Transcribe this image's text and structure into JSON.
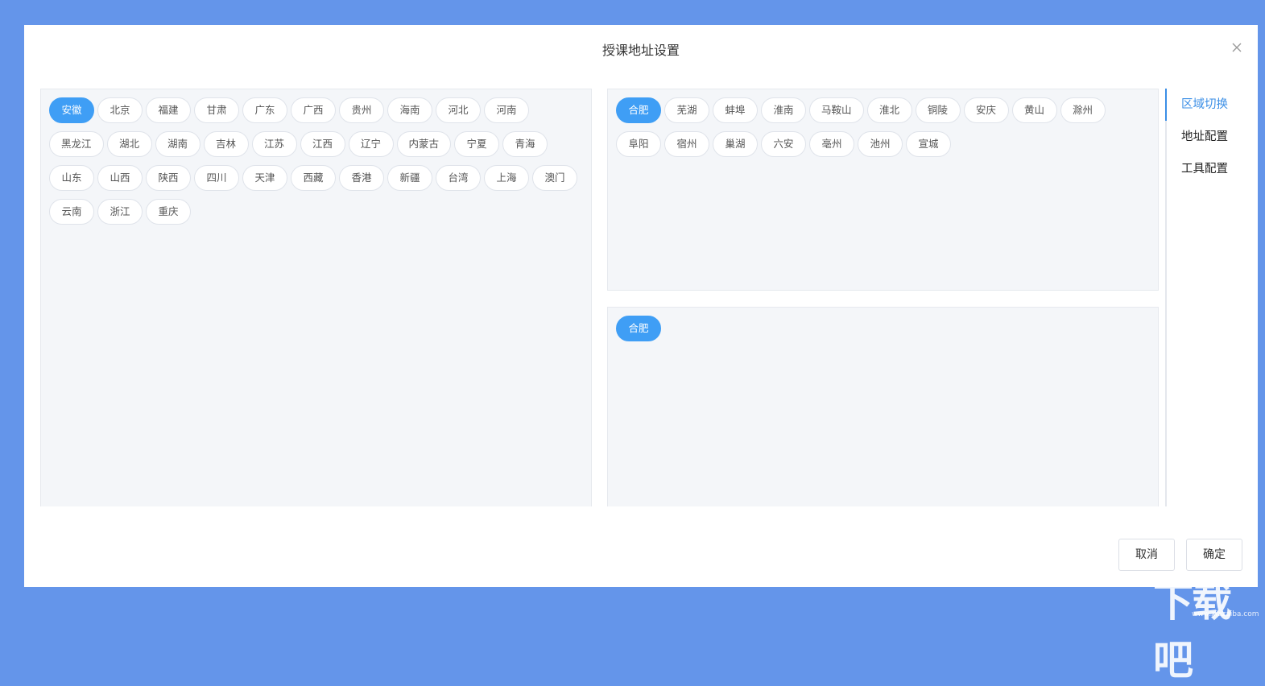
{
  "dialog": {
    "title": "授课地址设置"
  },
  "provinces": [
    {
      "label": "安徽",
      "active": true
    },
    {
      "label": "北京"
    },
    {
      "label": "福建"
    },
    {
      "label": "甘肃"
    },
    {
      "label": "广东"
    },
    {
      "label": "广西"
    },
    {
      "label": "贵州"
    },
    {
      "label": "海南"
    },
    {
      "label": "河北"
    },
    {
      "label": "河南"
    },
    {
      "label": "黑龙江"
    },
    {
      "label": "湖北"
    },
    {
      "label": "湖南"
    },
    {
      "label": "吉林"
    },
    {
      "label": "江苏"
    },
    {
      "label": "江西"
    },
    {
      "label": "辽宁"
    },
    {
      "label": "内蒙古"
    },
    {
      "label": "宁夏"
    },
    {
      "label": "青海"
    },
    {
      "label": "山东"
    },
    {
      "label": "山西"
    },
    {
      "label": "陕西"
    },
    {
      "label": "四川"
    },
    {
      "label": "天津"
    },
    {
      "label": "西藏"
    },
    {
      "label": "香港"
    },
    {
      "label": "新疆"
    },
    {
      "label": "台湾"
    },
    {
      "label": "上海"
    },
    {
      "label": "澳门"
    },
    {
      "label": "云南"
    },
    {
      "label": "浙江"
    },
    {
      "label": "重庆"
    }
  ],
  "cities": [
    {
      "label": "合肥",
      "active": true
    },
    {
      "label": "芜湖"
    },
    {
      "label": "蚌埠"
    },
    {
      "label": "淮南"
    },
    {
      "label": "马鞍山"
    },
    {
      "label": "淮北"
    },
    {
      "label": "铜陵"
    },
    {
      "label": "安庆"
    },
    {
      "label": "黄山"
    },
    {
      "label": "滁州"
    },
    {
      "label": "阜阳"
    },
    {
      "label": "宿州"
    },
    {
      "label": "巢湖"
    },
    {
      "label": "六安"
    },
    {
      "label": "亳州"
    },
    {
      "label": "池州"
    },
    {
      "label": "宣城"
    }
  ],
  "selected": [
    {
      "label": "合肥",
      "active": true
    }
  ],
  "side_nav": [
    {
      "label": "区域切换",
      "active": true
    },
    {
      "label": "地址配置"
    },
    {
      "label": "工具配置"
    }
  ],
  "footer": {
    "cancel_label": "取消",
    "confirm_label": "确定"
  },
  "watermark": {
    "text": "下载吧",
    "url": "www.xiazaiba.com"
  },
  "colors": {
    "background": "#6495ea",
    "accent": "#3f9ef5",
    "nav_active": "#3a8ee6"
  }
}
